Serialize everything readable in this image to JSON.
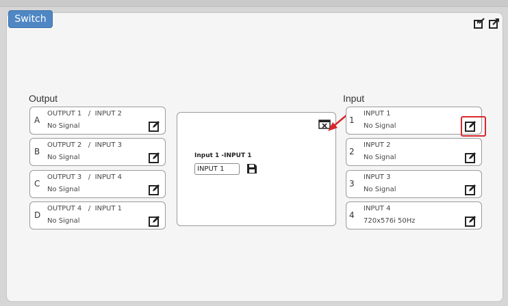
{
  "panel": {
    "title": "Switch"
  },
  "output_section": {
    "label": "Output",
    "items": [
      {
        "letter": "A",
        "output": "OUTPUT 1",
        "separator": "/",
        "input": "INPUT 2",
        "status": "No Signal"
      },
      {
        "letter": "B",
        "output": "OUTPUT 2",
        "separator": "/",
        "input": "INPUT 3",
        "status": "No Signal"
      },
      {
        "letter": "C",
        "output": "OUTPUT 3",
        "separator": "/",
        "input": "INPUT 4",
        "status": "No Signal"
      },
      {
        "letter": "D",
        "output": "OUTPUT 4",
        "separator": "/",
        "input": "INPUT 1",
        "status": "No Signal"
      }
    ]
  },
  "input_section": {
    "label": "Input",
    "items": [
      {
        "number": "1",
        "name": "INPUT 1",
        "status": "No Signal"
      },
      {
        "number": "2",
        "name": "INPUT 2",
        "status": "No Signal"
      },
      {
        "number": "3",
        "name": "INPUT 3",
        "status": "No Signal"
      },
      {
        "number": "4",
        "name": "INPUT 4",
        "status": "720x576i 50Hz"
      }
    ]
  },
  "editor": {
    "title": "Input 1 -INPUT 1",
    "name_value": "INPUT 1"
  },
  "icons": {
    "edit": "edit-icon",
    "save": "save-icon",
    "close": "close-icon",
    "export": "export-icon",
    "import": "import-icon"
  },
  "colors": {
    "tab": "#4f87c4",
    "highlight": "#d9262b"
  }
}
